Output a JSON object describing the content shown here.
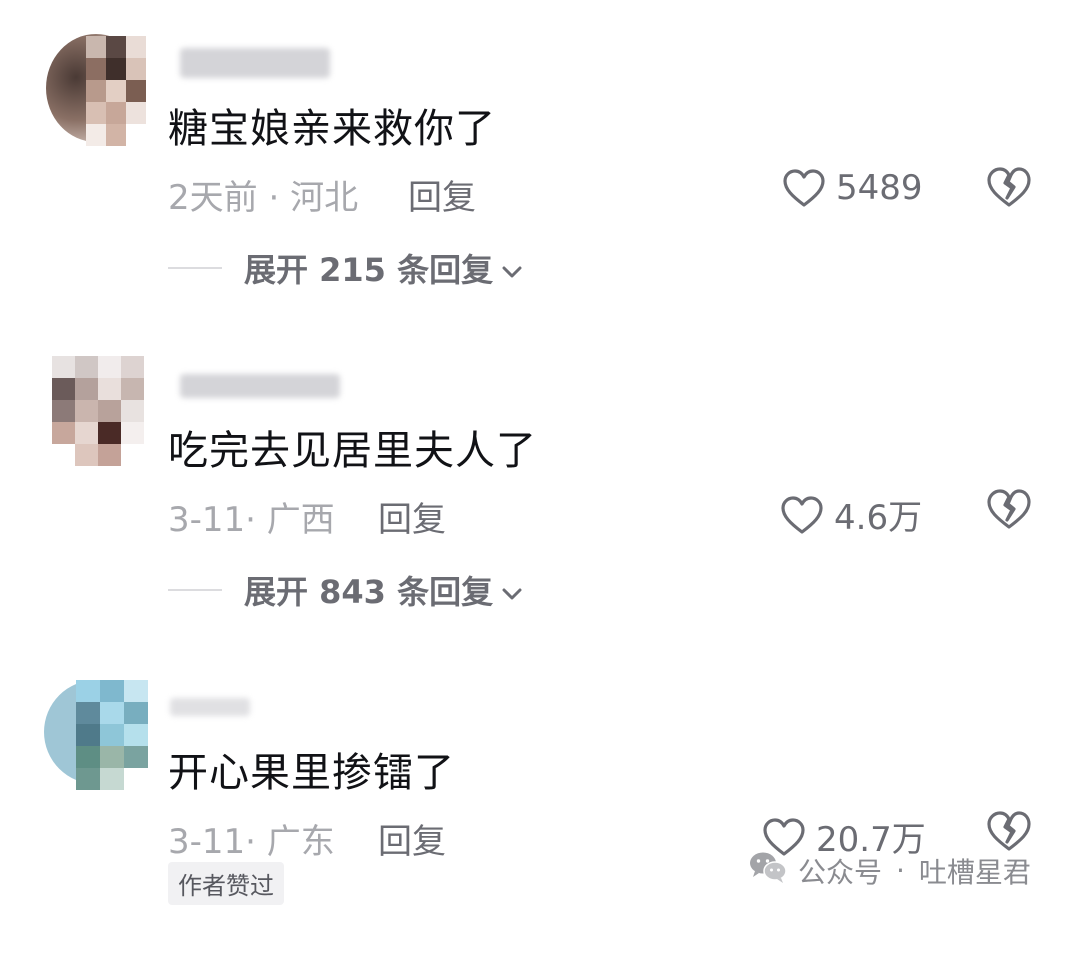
{
  "comments": [
    {
      "text": "糖宝娘亲来救你了",
      "date": "2天前",
      "location": "河北",
      "reply_label": "回复",
      "likes": "5489",
      "expand_label": "展开 215 条回复"
    },
    {
      "text": "吃完去见居里夫人了",
      "date": "3-11",
      "location": "广西",
      "reply_label": "回复",
      "likes": "4.6万",
      "expand_label": "展开 843 条回复"
    },
    {
      "text": "开心果里掺镭了",
      "date": "3-11",
      "location": "广东",
      "reply_label": "回复",
      "likes": "20.7万",
      "badge": "作者赞过"
    }
  ],
  "watermark": {
    "prefix": "公众号",
    "separator": "·",
    "account": "吐槽星君"
  },
  "icons": {
    "like": "heart-outline-icon",
    "dislike": "broken-heart-icon",
    "expand": "chevron-down-icon",
    "watermark": "wechat-icon"
  }
}
